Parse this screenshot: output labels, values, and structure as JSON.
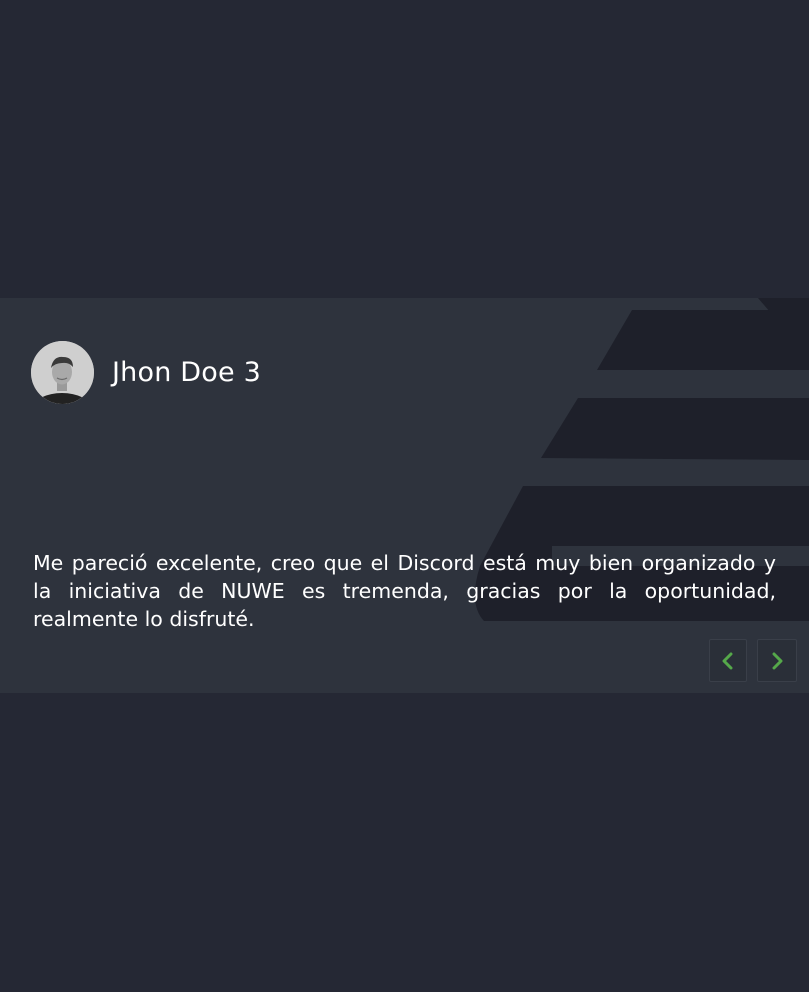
{
  "testimonial": {
    "author_name": "Jhon Doe 3",
    "quote": "Me pareció excelente, creo que el Discord está muy bien organizado y la iniciativa de NUWE es tremenda, gracias por la oportunidad, realmente lo disfruté."
  },
  "navigation": {
    "prev_icon": "chevron-left-icon",
    "next_icon": "chevron-right-icon"
  },
  "colors": {
    "page_background": "#252834",
    "card_background": "#2e333d",
    "accent": "#55a84a",
    "text": "#ffffff"
  }
}
